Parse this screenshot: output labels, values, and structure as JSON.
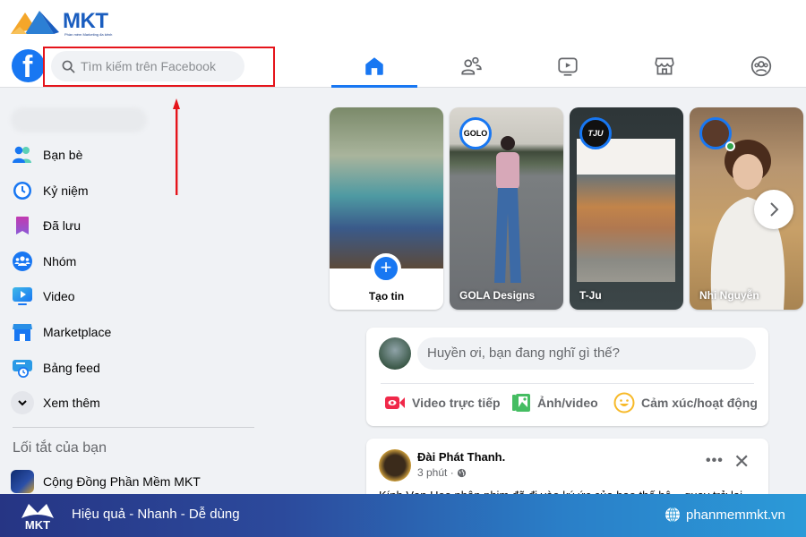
{
  "watermark": {
    "brand": "MKT",
    "tagline": "Phần mềm Marketing đa kênh"
  },
  "header": {
    "search_placeholder": "Tìm kiếm trên Facebook",
    "nav_tabs": [
      {
        "name": "home",
        "icon": "home-icon",
        "active": true
      },
      {
        "name": "friends",
        "icon": "friends-icon",
        "active": false
      },
      {
        "name": "watch",
        "icon": "video-icon",
        "active": false
      },
      {
        "name": "marketplace",
        "icon": "store-icon",
        "active": false
      },
      {
        "name": "groups",
        "icon": "groups-icon",
        "active": false
      }
    ],
    "active_color": "#1877f2"
  },
  "annotation": {
    "highlight_color": "#e5141b"
  },
  "sidebar": {
    "items": [
      {
        "label": "Bạn bè",
        "icon": "friends-icon"
      },
      {
        "label": "Kỷ niệm",
        "icon": "memories-clock-icon"
      },
      {
        "label": "Đã lưu",
        "icon": "bookmark-icon"
      },
      {
        "label": "Nhóm",
        "icon": "groups-icon"
      },
      {
        "label": "Video",
        "icon": "video-icon"
      },
      {
        "label": "Marketplace",
        "icon": "store-icon"
      },
      {
        "label": "Bảng feed",
        "icon": "feed-icon"
      },
      {
        "label": "Xem thêm",
        "icon": "chevron-down-icon"
      }
    ],
    "shortcuts_heading": "Lối tắt của bạn",
    "shortcuts": [
      {
        "label": "Cộng Đồng Phần Mềm MKT"
      }
    ]
  },
  "stories": {
    "create_label": "Tạo tin",
    "items": [
      {
        "name": "GOLA Designs",
        "badge": "GOLO"
      },
      {
        "name": "T-Ju",
        "badge": "TJU"
      },
      {
        "name": "Nhi Nguyễn",
        "badge": "",
        "online": true
      }
    ]
  },
  "composer": {
    "placeholder": "Huyền ơi, bạn đang nghĩ gì thế?",
    "actions": [
      {
        "label": "Video trực tiếp",
        "icon": "live-video-icon",
        "color": "#f02849"
      },
      {
        "label": "Ảnh/video",
        "icon": "photo-icon",
        "color": "#45bd62"
      },
      {
        "label": "Cảm xúc/hoạt động",
        "icon": "smiley-icon",
        "color": "#f7b928"
      }
    ]
  },
  "post": {
    "author": "Đài Phát Thanh.",
    "time": "3 phút ·",
    "text_preview": "Kính Vạn Hoa nhân phim đã đi vào ký ức của bao thế hệ... quay trở lại"
  },
  "banner": {
    "slogan": "Hiệu quả - Nhanh  - Dễ dùng",
    "website": "phanmemmkt.vn",
    "logo_text": "MKT"
  }
}
